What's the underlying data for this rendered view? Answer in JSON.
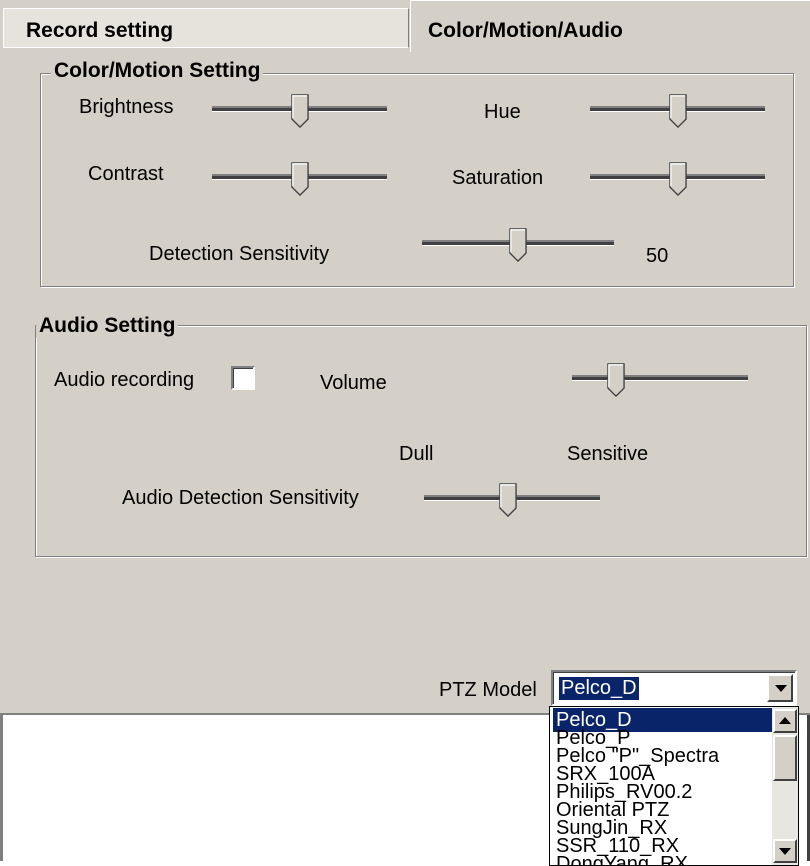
{
  "tabs": [
    {
      "label": "Record setting"
    },
    {
      "label": "Color/Motion/Audio"
    }
  ],
  "color_motion": {
    "title": "Color/Motion Setting",
    "brightness": {
      "label": "Brightness",
      "level": 0.5
    },
    "hue": {
      "label": "Hue",
      "level": 0.5
    },
    "contrast": {
      "label": "Contrast",
      "level": 0.5
    },
    "saturation": {
      "label": "Saturation",
      "level": 0.5
    },
    "detection": {
      "label": "Detection Sensitivity",
      "value": "50",
      "level": 0.5
    }
  },
  "audio": {
    "title": "Audio Setting",
    "recording": {
      "label": "Audio recording",
      "checked": false
    },
    "volume": {
      "label": "Volume",
      "level": 0.3
    },
    "dull": "Dull",
    "sensitive": "Sensitive",
    "detection": {
      "label": "Audio Detection Sensitivity",
      "level": 0.5
    }
  },
  "ptz": {
    "label": "PTZ Model",
    "selected": "Pelco_D",
    "options": [
      "Pelco_D",
      "Pelco_P",
      "Pelco \"P\"_Spectra",
      "SRX_100A",
      "Philips_RV00.2",
      "Oriental PTZ",
      "SungJin_RX",
      "SSR_110_RX",
      "DongYang_RX"
    ]
  }
}
